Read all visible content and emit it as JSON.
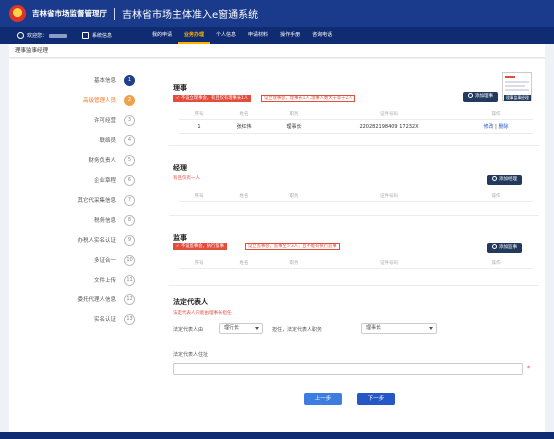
{
  "header": {
    "org_name": "吉林省市场监督管理厅",
    "system_title": "吉林省市场主体准入e窗通系统"
  },
  "nav": {
    "welcome": "欢迎您：",
    "messages": "系统信息",
    "items": [
      {
        "label": "我的申请",
        "active": false
      },
      {
        "label": "业务办理",
        "active": true
      },
      {
        "label": "个人信息",
        "active": false
      },
      {
        "label": "申请材料",
        "active": false
      },
      {
        "label": "操作手册",
        "active": false
      },
      {
        "label": "咨询电话",
        "active": false
      }
    ]
  },
  "breadcrumb": "理事监事经理",
  "steps": [
    {
      "label": "基本信息",
      "num": "1",
      "state": "done"
    },
    {
      "label": "高级管理人员",
      "num": "2",
      "state": "current"
    },
    {
      "label": "许可经营",
      "num": "3",
      "state": "todo"
    },
    {
      "label": "联络员",
      "num": "4",
      "state": "todo"
    },
    {
      "label": "财务负责人",
      "num": "5",
      "state": "todo"
    },
    {
      "label": "企业章程",
      "num": "6",
      "state": "todo"
    },
    {
      "label": "其它代采集信息",
      "num": "7",
      "state": "todo"
    },
    {
      "label": "税务信息",
      "num": "8",
      "state": "todo"
    },
    {
      "label": "办税人实名认证",
      "num": "9",
      "state": "todo"
    },
    {
      "label": "多证合一",
      "num": "10",
      "state": "todo"
    },
    {
      "label": "文件上传",
      "num": "11",
      "state": "todo"
    },
    {
      "label": "委托代理人信息",
      "num": "12",
      "state": "todo"
    },
    {
      "label": "实名认证",
      "num": "13",
      "state": "todo"
    }
  ],
  "board": {
    "title": "理事",
    "tip1": "✓ 不设立理事会，有且仅有理事长1人",
    "tip2": "设立理事会，理事长1人,理事人数大于等于2人",
    "add_label": "添加理事",
    "columns": [
      "序号",
      "姓名",
      "职务",
      "证件号码",
      "操作"
    ],
    "rows": [
      {
        "no": "1",
        "name": "张红伟",
        "role": "理事长",
        "id": "220282198409 17232X",
        "edit": "修改",
        "sep": "|",
        "del": "删除"
      }
    ]
  },
  "manager": {
    "title": "经理",
    "note": "有且仅有一人",
    "add_label": "添加经理",
    "columns": [
      "序号",
      "姓名",
      "职务",
      "证件号码",
      "操作"
    ]
  },
  "supervisor": {
    "title": "监事",
    "tip1": "✓ 不设监事会，执行监事",
    "tip2": "设立监事会，监事至少3人，且不能有执行监事",
    "add_label": "添加监事",
    "columns": [
      "序号",
      "姓名",
      "职务",
      "证件号码",
      "操作"
    ]
  },
  "legal": {
    "title": "法定代表人",
    "note": "法定代表人只能由理事长担任",
    "from_label": "法定代表人由",
    "from_value": "理行长",
    "role_label": "担任，法定代表人职务",
    "role_value": "理事长",
    "addr_label": "法定代表人住址",
    "req": "*"
  },
  "buttons": {
    "prev": "上一步",
    "next": "下一步"
  },
  "thumb_caption": "理事监事经理",
  "colors": {
    "header": "#1a3a8c",
    "nav": "#0f2c72",
    "accent": "#ffb100",
    "danger": "#e24d3c",
    "primary": "#2557c7"
  }
}
